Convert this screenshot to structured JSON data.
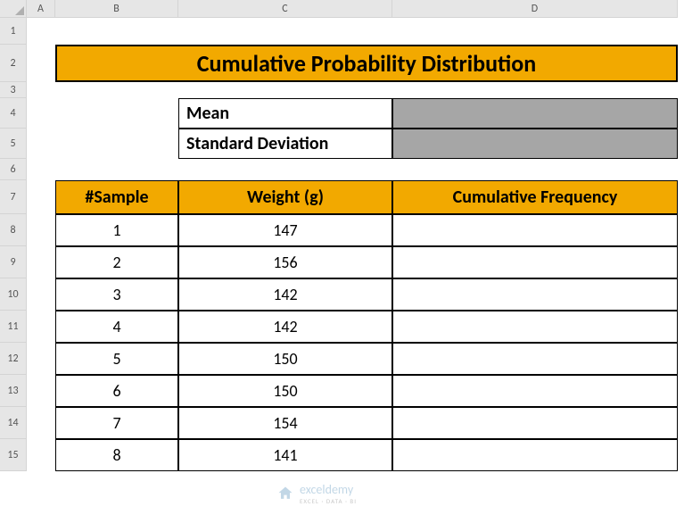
{
  "columns": [
    "A",
    "B",
    "C",
    "D"
  ],
  "rows": [
    "1",
    "2",
    "3",
    "4",
    "5",
    "6",
    "7",
    "8",
    "9",
    "10",
    "11",
    "12",
    "13",
    "14",
    "15"
  ],
  "title": "Cumulative Probability Distribution",
  "stats": {
    "mean_label": "Mean",
    "stddev_label": "Standard Deviation"
  },
  "headers": {
    "sample": "#Sample",
    "weight": "Weight (g)",
    "cumfreq": "Cumulative Frequency"
  },
  "data": [
    {
      "sample": "1",
      "weight": "147"
    },
    {
      "sample": "2",
      "weight": "156"
    },
    {
      "sample": "3",
      "weight": "142"
    },
    {
      "sample": "4",
      "weight": "142"
    },
    {
      "sample": "5",
      "weight": "150"
    },
    {
      "sample": "6",
      "weight": "150"
    },
    {
      "sample": "7",
      "weight": "154"
    },
    {
      "sample": "8",
      "weight": "141"
    }
  ],
  "watermark": {
    "name": "exceldemy",
    "sub": "EXCEL · DATA · BI"
  }
}
